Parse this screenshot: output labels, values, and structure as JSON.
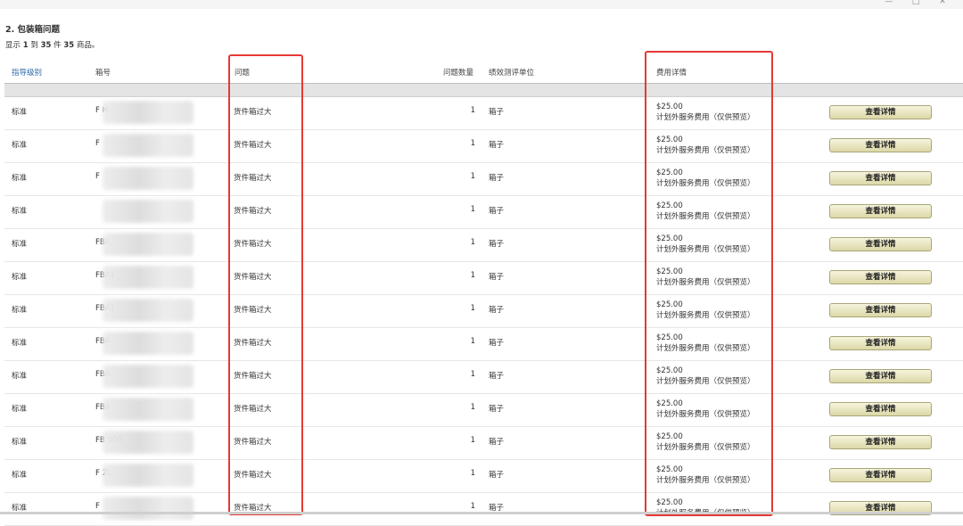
{
  "window": {
    "minimize": "—",
    "maximize": "□",
    "close": "✕"
  },
  "section": {
    "title": "2. 包装箱问题",
    "showing_prefix": "显示",
    "showing_from": "1",
    "showing_to_word": "到",
    "showing_to": "35",
    "showing_of_word": "件",
    "showing_total": "35",
    "showing_suffix": "商品。"
  },
  "columns": {
    "level": "指导级别",
    "box": "箱号",
    "issue": "问题",
    "qty": "问题数量",
    "unit": "绩效测评单位",
    "fee": "费用详情"
  },
  "rows": [
    {
      "level": "标准",
      "box": "F          H",
      "issue": "货件箱过大",
      "qty": "1",
      "unit": "箱子",
      "fee_amount": "$25.00",
      "fee_desc": "计划外服务费用（仅供预览）",
      "action": "查看详情"
    },
    {
      "level": "标准",
      "box": "F",
      "issue": "货件箱过大",
      "qty": "1",
      "unit": "箱子",
      "fee_amount": "$25.00",
      "fee_desc": "计划外服务费用（仅供预览）",
      "action": "查看详情"
    },
    {
      "level": "标准",
      "box": "F",
      "issue": "货件箱过大",
      "qty": "1",
      "unit": "箱子",
      "fee_amount": "$25.00",
      "fee_desc": "计划外服务费用（仅供预览）",
      "action": "查看详情"
    },
    {
      "level": "标准",
      "box": "",
      "issue": "货件箱过大",
      "qty": "1",
      "unit": "箱子",
      "fee_amount": "$25.00",
      "fee_desc": "计划外服务费用（仅供预览）",
      "action": "查看详情"
    },
    {
      "level": "标准",
      "box": "FBA",
      "issue": "货件箱过大",
      "qty": "1",
      "unit": "箱子",
      "fee_amount": "$25.00",
      "fee_desc": "计划外服务费用（仅供预览）",
      "action": "查看详情"
    },
    {
      "level": "标准",
      "box": "FBA1",
      "issue": "货件箱过大",
      "qty": "1",
      "unit": "箱子",
      "fee_amount": "$25.00",
      "fee_desc": "计划外服务费用（仅供预览）",
      "action": "查看详情"
    },
    {
      "level": "标准",
      "box": "FBA1",
      "issue": "货件箱过大",
      "qty": "1",
      "unit": "箱子",
      "fee_amount": "$25.00",
      "fee_desc": "计划外服务费用（仅供预览）",
      "action": "查看详情"
    },
    {
      "level": "标准",
      "box": "FBA",
      "issue": "货件箱过大",
      "qty": "1",
      "unit": "箱子",
      "fee_amount": "$25.00",
      "fee_desc": "计划外服务费用（仅供预览）",
      "action": "查看详情"
    },
    {
      "level": "标准",
      "box": "FBA",
      "issue": "货件箱过大",
      "qty": "1",
      "unit": "箱子",
      "fee_amount": "$25.00",
      "fee_desc": "计划外服务费用（仅供预览）",
      "action": "查看详情"
    },
    {
      "level": "标准",
      "box": "FBA",
      "issue": "货件箱过大",
      "qty": "1",
      "unit": "箱子",
      "fee_amount": "$25.00",
      "fee_desc": "计划外服务费用（仅供预览）",
      "action": "查看详情"
    },
    {
      "level": "标准",
      "box": "FB              000",
      "issue": "货件箱过大",
      "qty": "1",
      "unit": "箱子",
      "fee_amount": "$25.00",
      "fee_desc": "计划外服务费用（仅供预览）",
      "action": "查看详情"
    },
    {
      "level": "标准",
      "box": "F        2L",
      "issue": "货件箱过大",
      "qty": "1",
      "unit": "箱子",
      "fee_amount": "$25.00",
      "fee_desc": "计划外服务费用（仅供预览）",
      "action": "查看详情"
    },
    {
      "level": "标准",
      "box": "F",
      "issue": "货件箱过大",
      "qty": "1",
      "unit": "箱子",
      "fee_amount": "$25.00",
      "fee_desc": "计划外服务费用（仅供预览）",
      "action": "查看详情"
    }
  ]
}
